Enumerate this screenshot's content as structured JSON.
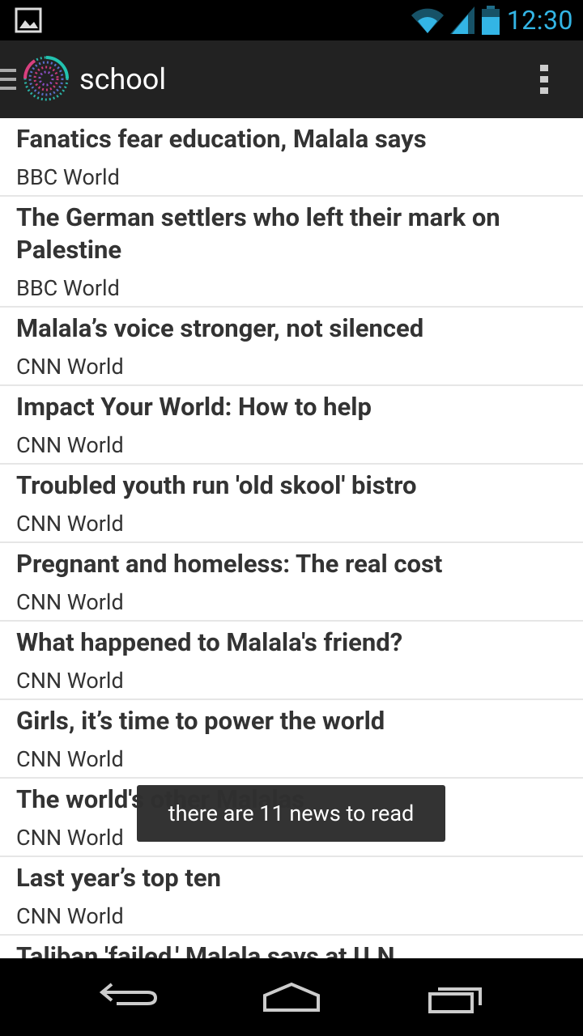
{
  "status": {
    "time": "12:30"
  },
  "app": {
    "title": "school"
  },
  "news": [
    {
      "headline": "Fanatics fear education, Malala says",
      "source": "BBC World"
    },
    {
      "headline": "The German settlers who left their mark on Palestine",
      "source": "BBC World"
    },
    {
      "headline": "Malala’s voice stronger, not silenced",
      "source": "CNN World"
    },
    {
      "headline": "Impact Your World: How to help",
      "source": "CNN World"
    },
    {
      "headline": "Troubled youth run 'old skool' bistro",
      "source": "CNN World"
    },
    {
      "headline": "Pregnant and homeless: The real cost",
      "source": "CNN World"
    },
    {
      "headline": "What happened to Malala's friend?",
      "source": "CNN World"
    },
    {
      "headline": "Girls, it’s time to power the world",
      "source": "CNN World"
    },
    {
      "headline": "The world's other Malalas",
      "source": "CNN World"
    },
    {
      "headline": "Last year’s top ten",
      "source": "CNN World"
    },
    {
      "headline": "Taliban 'failed,' Malala says at U.N.",
      "source": ""
    }
  ],
  "toast": {
    "text": "there are 11 news to read"
  },
  "icons": {
    "notification": "image-icon",
    "wifi": "wifi-icon",
    "signal": "signal-icon",
    "battery": "battery-icon",
    "drawer": "drawer-icon",
    "logo": "spiral-logo-icon",
    "overflow": "overflow-menu-icon",
    "back": "back-icon",
    "home": "home-icon",
    "recents": "recent-apps-icon"
  },
  "colors": {
    "accent": "#33b5e5",
    "action_bar": "#222222"
  }
}
